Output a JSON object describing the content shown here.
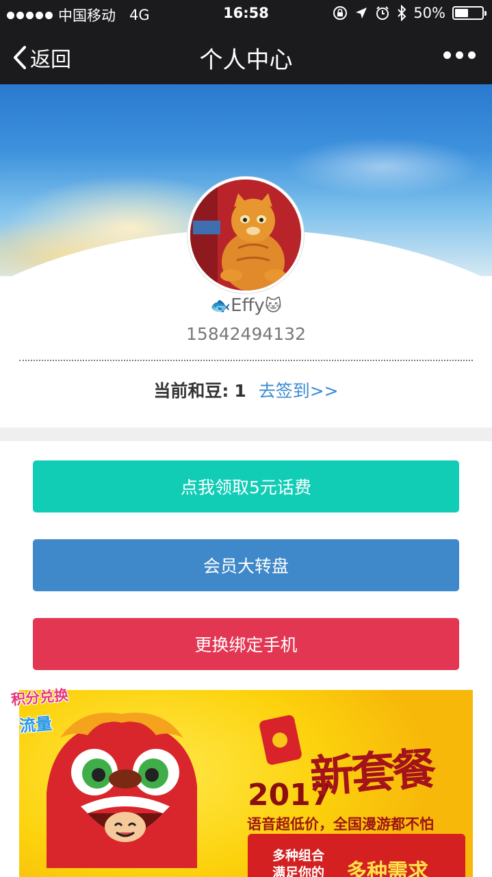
{
  "status_bar": {
    "carrier": "中国移动",
    "network": "4G",
    "time": "16:58",
    "battery_percent": "50%",
    "battery_level": 0.5,
    "icons": [
      "orientation-lock-icon",
      "location-icon",
      "alarm-icon",
      "bluetooth-icon",
      "battery-icon"
    ]
  },
  "nav": {
    "back_label": "返回",
    "title": "个人中心",
    "more_icon": "more-dots-icon"
  },
  "profile": {
    "name": "Effy",
    "name_prefix_emoji": "🐟",
    "name_suffix_emoji": "🐱",
    "phone": "15842494132",
    "beans_label": "当前和豆:",
    "beans_value": "1",
    "sign_in_link": "去签到>>"
  },
  "buttons": {
    "claim_fee": "点我领取5元话费",
    "lucky_wheel": "会员大转盘",
    "change_phone": "更换绑定手机"
  },
  "colors": {
    "claim_fee": "#11cdb6",
    "lucky_wheel": "#3f88c9",
    "change_phone": "#e33652",
    "link": "#3a8ad2"
  },
  "banner": {
    "sticker_line1": "积分兑换",
    "sticker_line2": "流量",
    "year": "2017",
    "title": "新套餐",
    "subtitle": "语音超低价，全国漫游都不怕",
    "box_left_line1": "多种组合",
    "box_left_line2": "满足你的",
    "box_right": "多种需求"
  }
}
